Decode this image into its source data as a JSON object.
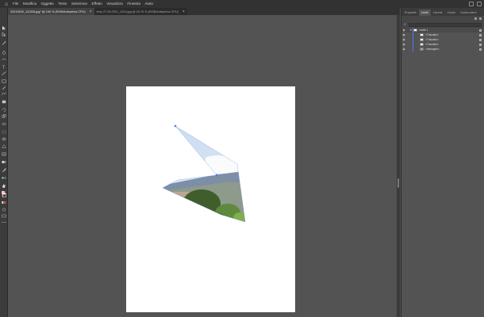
{
  "menubar": {
    "app_icon": "home-icon",
    "items": [
      "File",
      "Modifica",
      "Oggetto",
      "Testo",
      "Selezione",
      "Effetto",
      "Visualizza",
      "Finestra",
      "Aiuto"
    ]
  },
  "tabs": [
    {
      "label": "20210520_111528.jpg* @ 150 % (RGB/Anteprima CPU)",
      "active": true
    },
    {
      "label": "bery 27.05.2021_1200.jpg @ 15,79 % (RGB/Anteprima CPU)",
      "active": false
    }
  ],
  "panel": {
    "tabs": [
      "Proprietà",
      "Livelli",
      "Librerie",
      "Colore",
      "Guida colore"
    ],
    "active_tab": "Livelli",
    "layers": [
      {
        "name": "Livello 1",
        "level": 0
      },
      {
        "name": "<Tracciato>",
        "level": 1
      },
      {
        "name": "<Tracciato>",
        "level": 1
      },
      {
        "name": "<Tracciato>",
        "level": 1
      },
      {
        "name": "<Immagine>",
        "level": 1
      }
    ]
  },
  "colors": {
    "accent": "#4b7cf0",
    "chrome_dark": "#323232",
    "workspace": "#535353"
  }
}
